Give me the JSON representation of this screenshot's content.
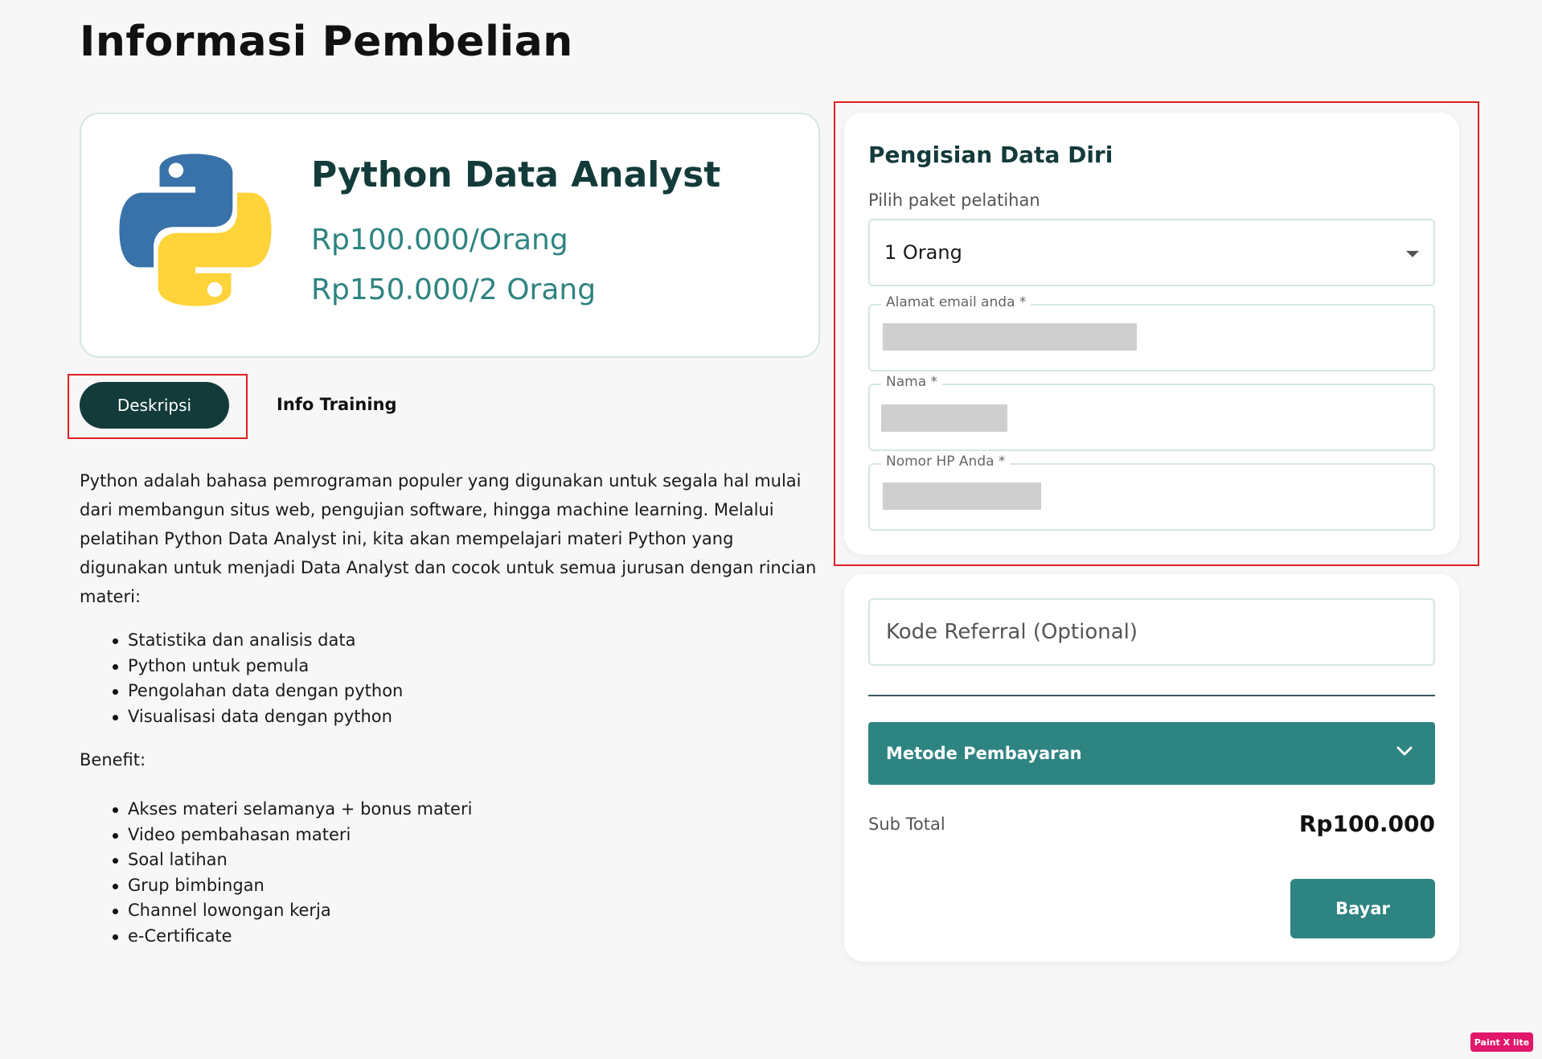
{
  "page": {
    "title": "Informasi Pembelian"
  },
  "product": {
    "logo": "python-logo",
    "name": "Python Data Analyst",
    "price_single": "Rp100.000/Orang",
    "price_double": "Rp150.000/2 Orang"
  },
  "tabs": [
    {
      "label": "Deskripsi",
      "active": true
    },
    {
      "label": "Info Training",
      "active": false
    }
  ],
  "description": {
    "paragraph": "Python adalah bahasa pemrograman populer yang digunakan untuk segala hal mulai dari membangun situs web, pengujian software, hingga machine learning. Melalui pelatihan Python Data Analyst ini, kita akan mempelajari materi Python yang digunakan untuk menjadi Data Analyst dan cocok untuk semua jurusan dengan rincian materi:",
    "materi": [
      "Statistika dan analisis data",
      "Python untuk pemula",
      "Pengolahan data dengan python",
      "Visualisasi data dengan python"
    ],
    "benefit_label": "Benefit:",
    "benefits": [
      "Akses materi selamanya + bonus materi",
      "Video pembahasan materi",
      "Soal latihan",
      "Grup bimbingan",
      "Channel lowongan kerja",
      "e-Certificate"
    ]
  },
  "form": {
    "title": "Pengisian Data Diri",
    "package_label": "Pilih paket pelatihan",
    "package_value": "1 Orang",
    "email_label": "Alamat email anda *",
    "name_label": "Nama *",
    "phone_label": "Nomor HP Anda *"
  },
  "payment": {
    "referral_placeholder": "Kode Referral (Optional)",
    "method_label": "Metode Pembayaran",
    "subtotal_label": "Sub Total",
    "subtotal_value": "Rp100.000",
    "pay_label": "Bayar"
  },
  "badge": {
    "label": "Paint X lite"
  },
  "colors": {
    "primary_dark": "#133b3a",
    "accent_teal": "#2e8481",
    "highlight_red": "#e02020"
  }
}
